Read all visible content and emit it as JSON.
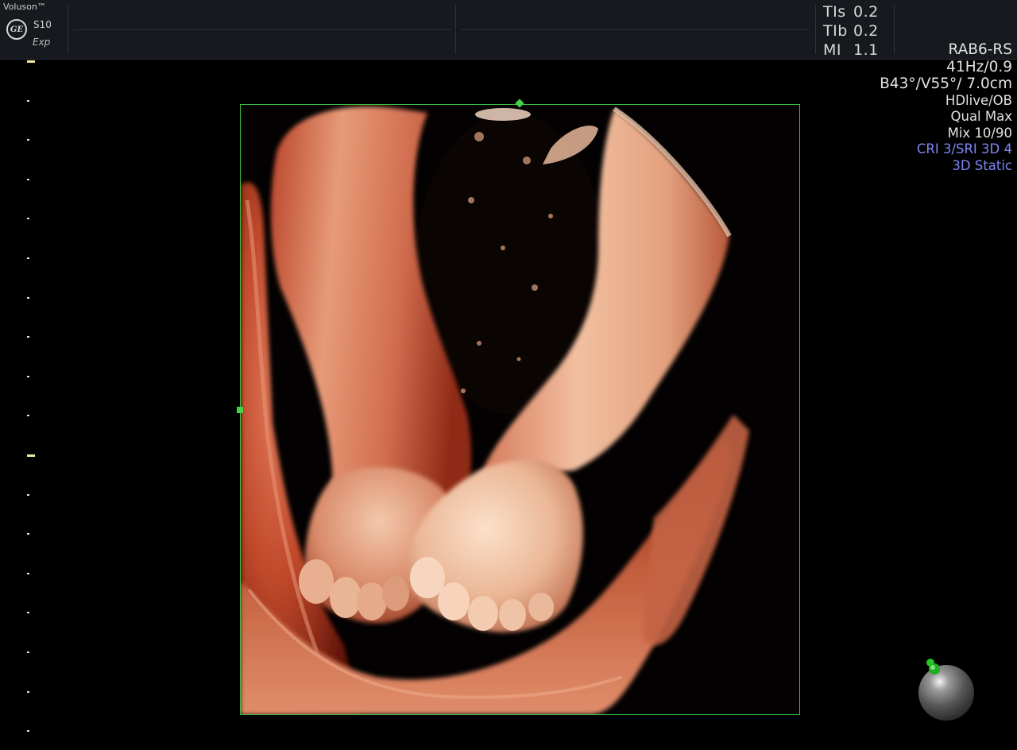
{
  "header": {
    "brand": "Voluson™",
    "logo_text": "GE",
    "model": "S10",
    "mode": "Exp",
    "indices": [
      {
        "label": "TIs",
        "value": "0.2"
      },
      {
        "label": "TIb",
        "value": "0.2"
      },
      {
        "label": "MI",
        "value": "1.1"
      }
    ]
  },
  "params": {
    "probe": "RAB6-RS",
    "frame_rate": "41Hz/0.9",
    "geometry": "B43°/V55°/ 7.0cm",
    "render_mode": "HDlive/OB",
    "quality": "Qual Max",
    "mix": "Mix 10/90",
    "cri_sri": "CRI 3/SRI 3D 4",
    "acq_mode": "3D Static"
  },
  "colors": {
    "header_bg": "#16191d",
    "box_border": "#3fbf3f",
    "accent_blue": "#7f86f2",
    "tissue_light": "#f2c7a6",
    "tissue_dark": "#8a1f10"
  },
  "render": {
    "subject": "3D rendered fetal feet"
  }
}
